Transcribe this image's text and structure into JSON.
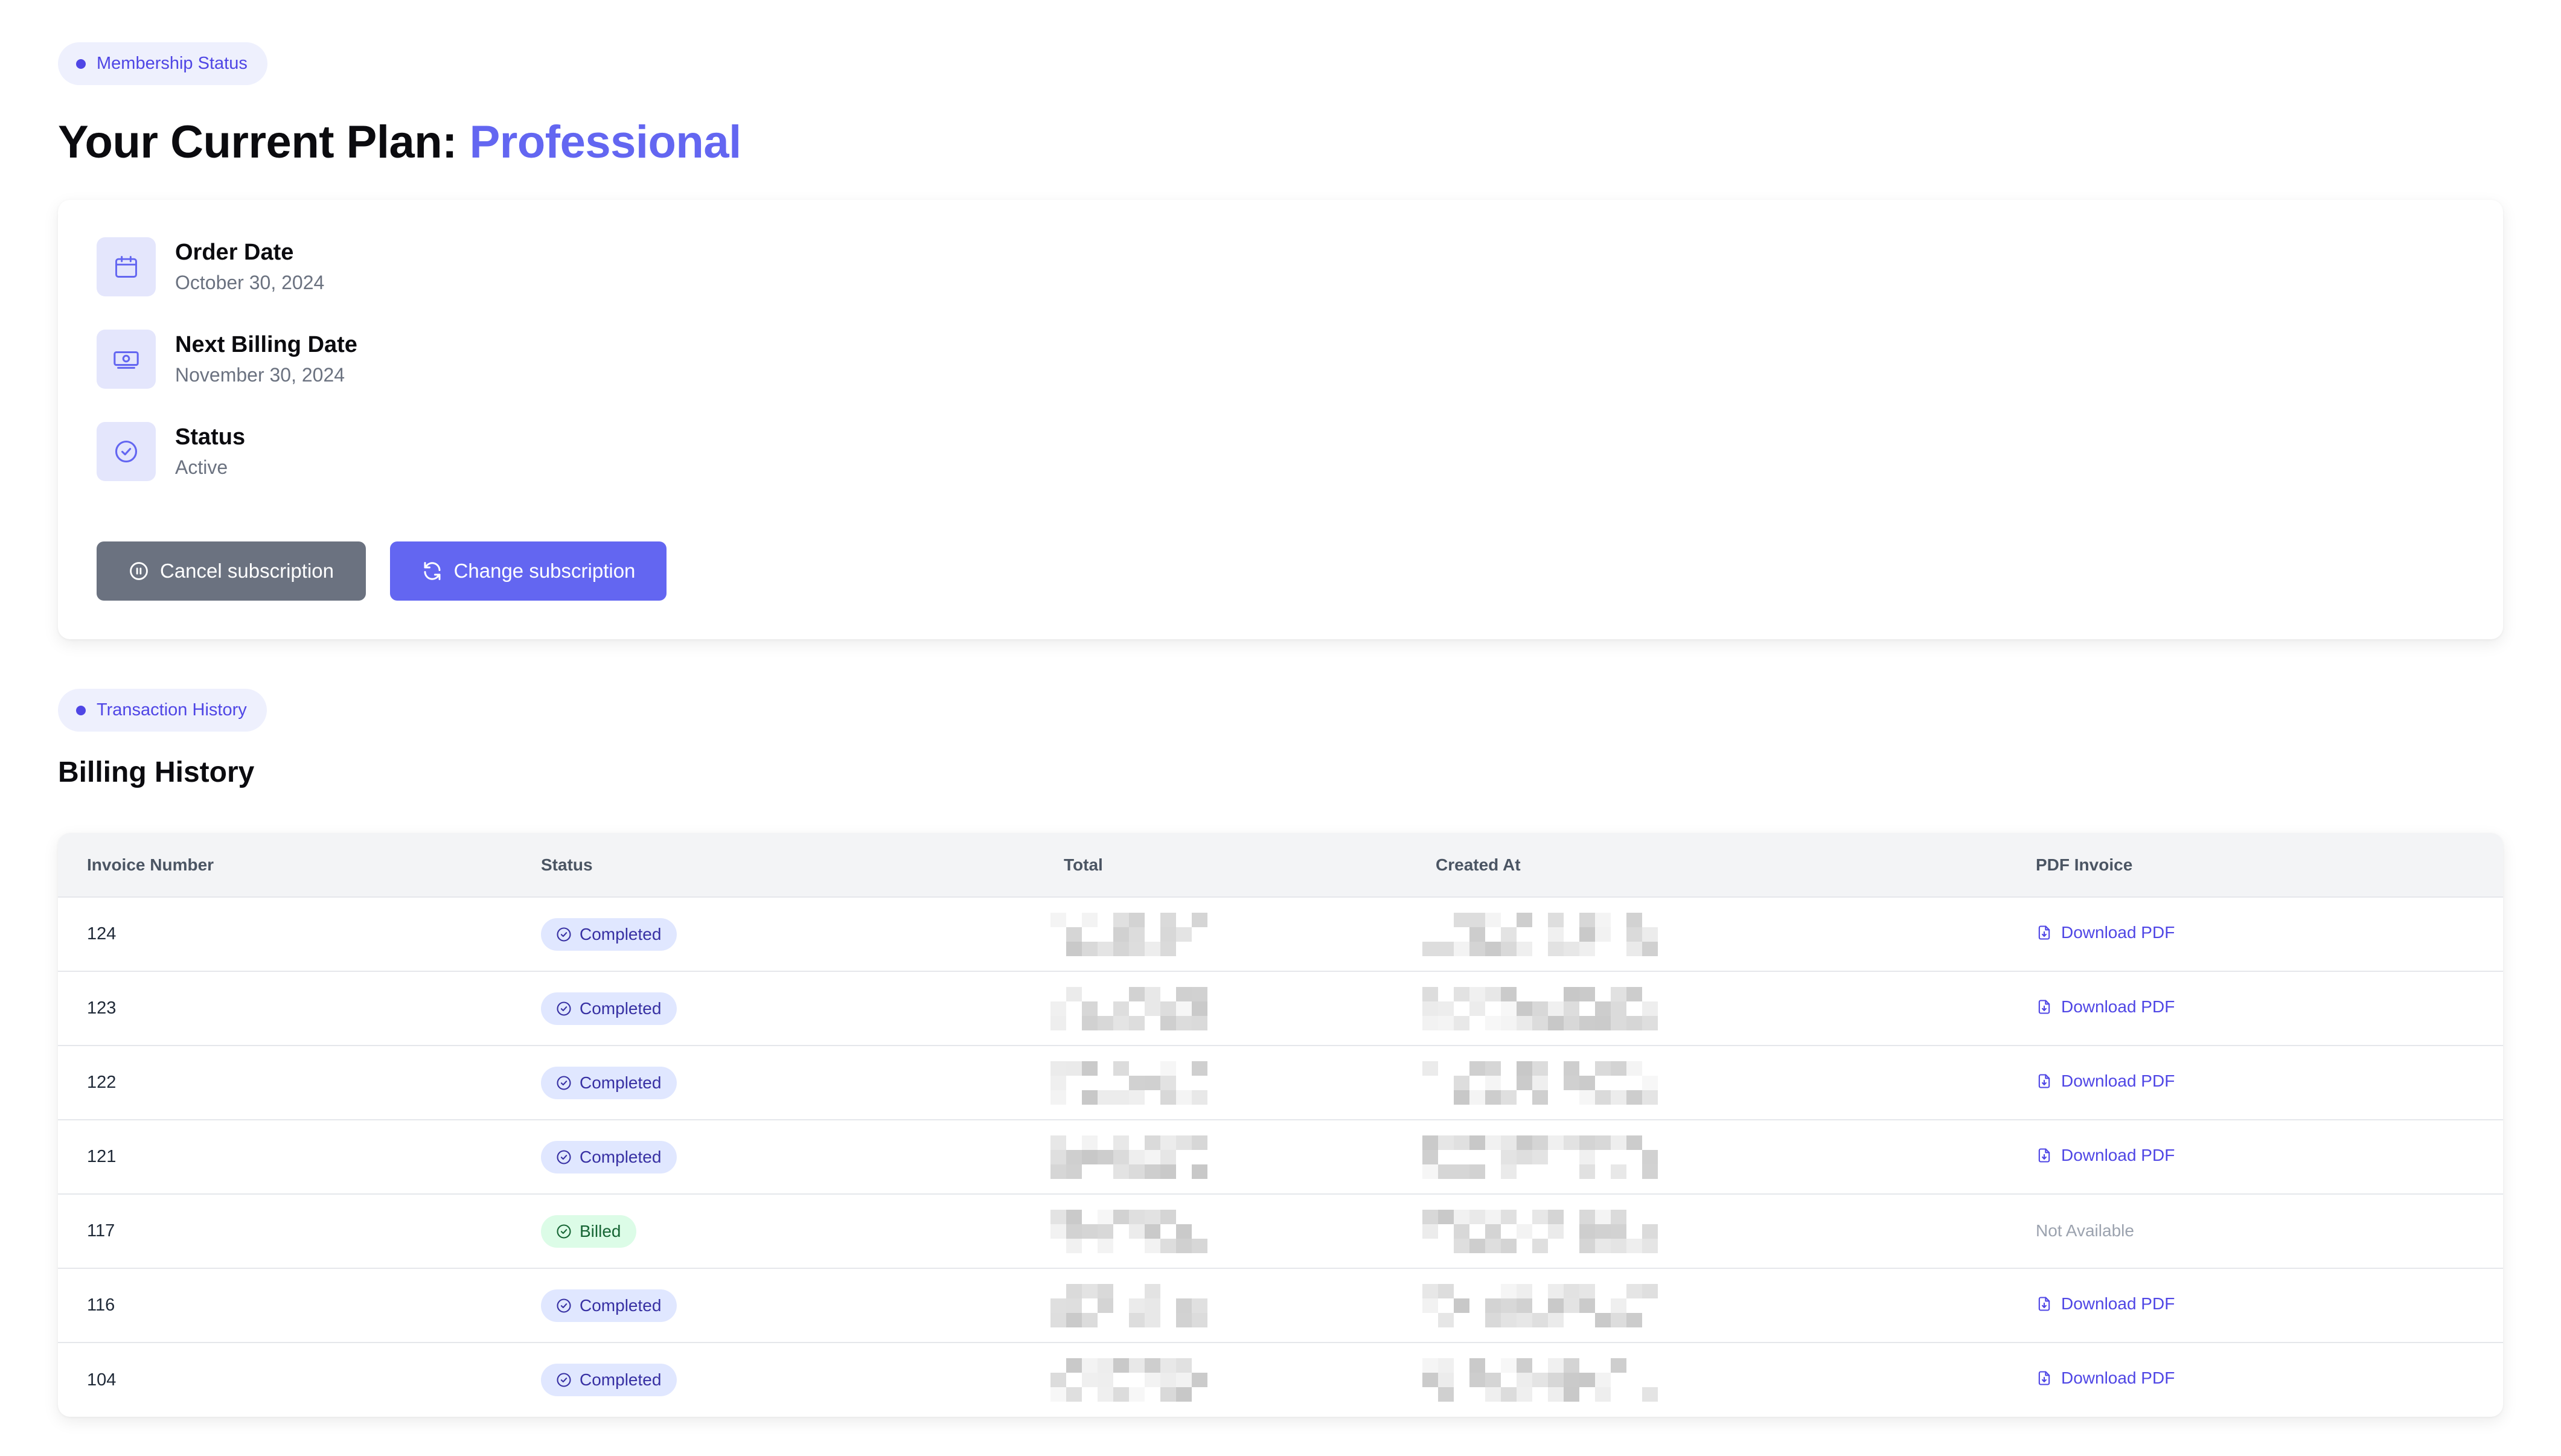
{
  "membership": {
    "badge_label": "Membership Status",
    "title_prefix": "Your Current Plan: ",
    "plan_name": "Professional",
    "details": [
      {
        "label": "Order Date",
        "value": "October 30, 2024",
        "icon": "calendar-icon"
      },
      {
        "label": "Next Billing Date",
        "value": "November 30, 2024",
        "icon": "banknote-icon"
      },
      {
        "label": "Status",
        "value": "Active",
        "icon": "check-circle-icon"
      }
    ],
    "cancel_label": "Cancel subscription",
    "change_label": "Change subscription"
  },
  "history": {
    "badge_label": "Transaction History",
    "title": "Billing History",
    "columns": [
      "Invoice Number",
      "Status",
      "Total",
      "Created At",
      "PDF Invoice"
    ],
    "rows": [
      {
        "invoice": "124",
        "status": "Completed",
        "pdf": "Download PDF"
      },
      {
        "invoice": "123",
        "status": "Completed",
        "pdf": "Download PDF"
      },
      {
        "invoice": "122",
        "status": "Completed",
        "pdf": "Download PDF"
      },
      {
        "invoice": "121",
        "status": "Completed",
        "pdf": "Download PDF"
      },
      {
        "invoice": "117",
        "status": "Billed",
        "pdf": "Not Available"
      },
      {
        "invoice": "116",
        "status": "Completed",
        "pdf": "Download PDF"
      },
      {
        "invoice": "104",
        "status": "Completed",
        "pdf": "Download PDF"
      }
    ]
  },
  "colors": {
    "accent": "#6366f1",
    "accent_dark": "#4f46e5",
    "cancel_button": "#6b7280",
    "badge_completed_bg": "#e0e7ff",
    "badge_billed_bg": "#dcfce7"
  }
}
